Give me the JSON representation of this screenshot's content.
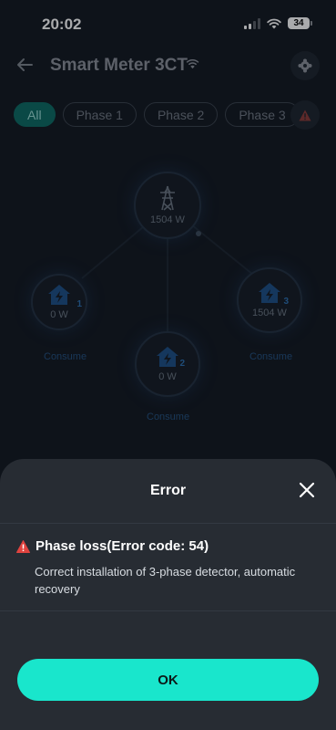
{
  "status_bar": {
    "time": "20:02",
    "battery": "34"
  },
  "header": {
    "title": "Smart Meter 3CT"
  },
  "tabs": [
    {
      "label": "All",
      "active": true
    },
    {
      "label": "Phase 1",
      "active": false
    },
    {
      "label": "Phase 2",
      "active": false
    },
    {
      "label": "Phase 3",
      "active": false
    }
  ],
  "diagram": {
    "grid": {
      "value": "1504 W"
    },
    "phase1": {
      "number": "1",
      "value": "0 W",
      "label": "Consume"
    },
    "phase2": {
      "number": "2",
      "value": "0 W",
      "label": "Consume"
    },
    "phase3": {
      "number": "3",
      "value": "1504 W",
      "label": "Consume"
    }
  },
  "dialog": {
    "title": "Error",
    "error_title": "Phase loss(Error code: 54)",
    "error_description": "Correct installation of 3-phase detector, automatic recovery",
    "ok_label": "OK"
  },
  "colors": {
    "accent": "#19e6cc",
    "warning": "#e0433f",
    "sheet": "#272c33"
  }
}
